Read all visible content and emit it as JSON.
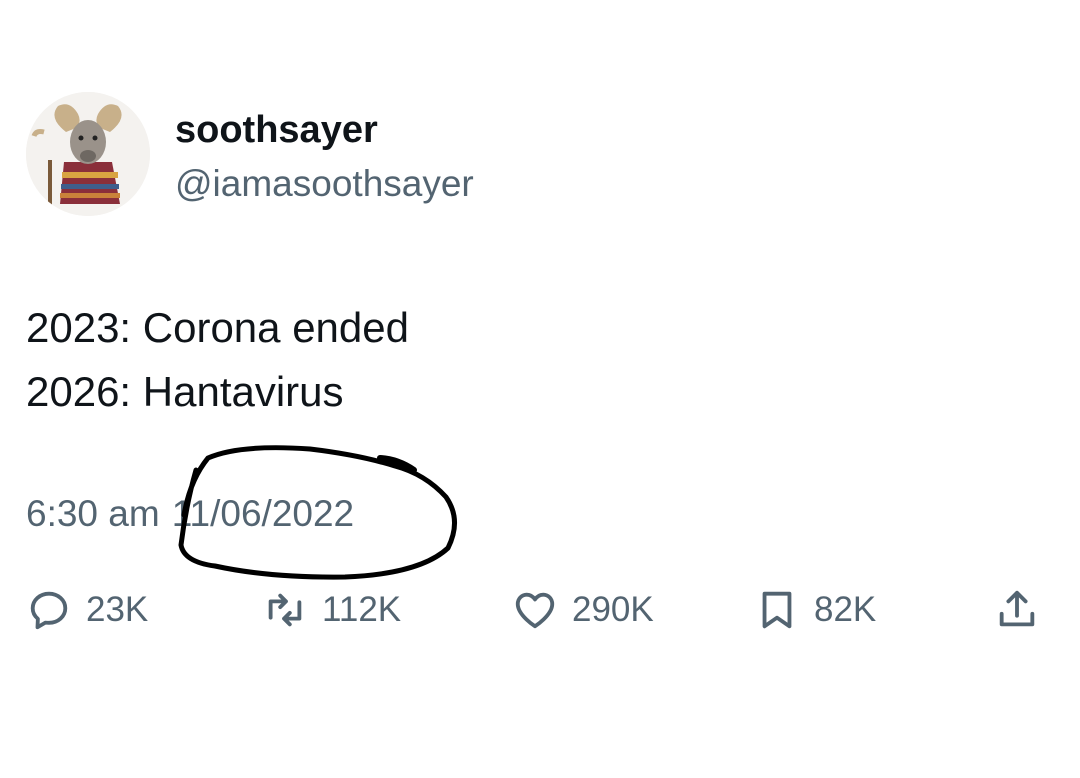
{
  "user": {
    "display_name": "soothsayer",
    "handle": "@iamasoothsayer",
    "avatar_icon": "ram-soothsayer-avatar"
  },
  "tweet": {
    "lines": [
      "2023: Corona ended",
      "2026: Hantavirus"
    ],
    "time": "6:30 am",
    "date": "11/06/2022"
  },
  "actions": {
    "reply": {
      "icon": "reply-icon",
      "count": "23K"
    },
    "retweet": {
      "icon": "retweet-icon",
      "count": "112K"
    },
    "like": {
      "icon": "heart-icon",
      "count": "290K"
    },
    "bookmark": {
      "icon": "bookmark-icon",
      "count": "82K"
    },
    "share": {
      "icon": "share-icon"
    }
  },
  "colors": {
    "text": "#0f1419",
    "secondary": "#536471",
    "annotation": "#000000"
  }
}
